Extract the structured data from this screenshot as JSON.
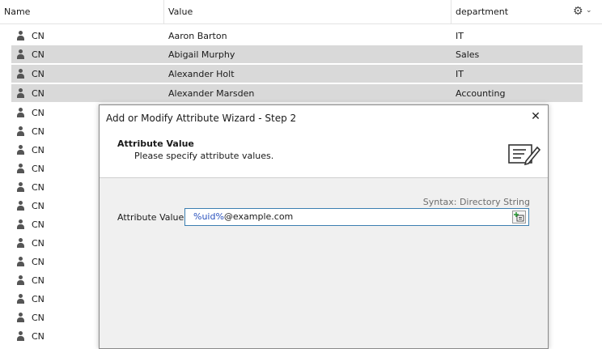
{
  "header": {
    "col_name": "Name",
    "col_value": "Value",
    "col_department": "department",
    "settings_icon": "gear-icon"
  },
  "rows": [
    {
      "name": "CN",
      "value": "Aaron Barton",
      "department": "IT",
      "selected": false
    },
    {
      "name": "CN",
      "value": "Abigail Murphy",
      "department": "Sales",
      "selected": true
    },
    {
      "name": "CN",
      "value": "Alexander Holt",
      "department": "IT",
      "selected": true
    },
    {
      "name": "CN",
      "value": "Alexander Marsden",
      "department": "Accounting",
      "selected": true
    },
    {
      "name": "CN",
      "value": "",
      "department": "",
      "selected": false
    },
    {
      "name": "CN",
      "value": "",
      "department": "",
      "selected": false
    },
    {
      "name": "CN",
      "value": "",
      "department": "",
      "selected": false
    },
    {
      "name": "CN",
      "value": "",
      "department": "",
      "selected": false
    },
    {
      "name": "CN",
      "value": "",
      "department": "",
      "selected": false
    },
    {
      "name": "CN",
      "value": "",
      "department": "",
      "selected": false
    },
    {
      "name": "CN",
      "value": "",
      "department": "",
      "selected": false
    },
    {
      "name": "CN",
      "value": "",
      "department": "",
      "selected": false
    },
    {
      "name": "CN",
      "value": "",
      "department": "",
      "selected": false
    },
    {
      "name": "CN",
      "value": "",
      "department": "",
      "selected": false
    },
    {
      "name": "CN",
      "value": "",
      "department": "",
      "selected": false
    },
    {
      "name": "CN",
      "value": "",
      "department": "",
      "selected": false
    },
    {
      "name": "CN",
      "value": "",
      "department": "",
      "selected": false
    }
  ],
  "dialog": {
    "title": "Add or Modify Attribute Wizard - Step 2",
    "heading": "Attribute Value",
    "subheading": "Please specify attribute values.",
    "syntax": "Syntax: Directory String",
    "attr_label": "Attribute Value:",
    "attr_value_var": "%uid%",
    "attr_value_rest": "@example.com"
  },
  "colors": {
    "selection": "#d9d9d9",
    "dialog_bg": "#f0f0f0",
    "variable_text": "#2a52be",
    "input_border": "#3c7fb1"
  }
}
